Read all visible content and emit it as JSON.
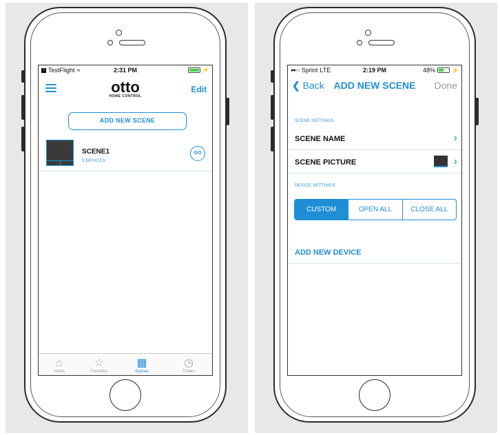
{
  "left": {
    "status": {
      "carrier": "TestFlight",
      "time": "2:31 PM"
    },
    "header": {
      "logo_word": "otto",
      "logo_sub": "HOME CONTROL",
      "edit_label": "Edit"
    },
    "add_scene_label": "ADD NEW SCENE",
    "scene": {
      "name": "SCENE1",
      "devices": "3 DEVICES",
      "go_label": "GO"
    },
    "tabs": [
      {
        "label": "Home",
        "icon": "home-icon"
      },
      {
        "label": "Favorites",
        "icon": "star-icon"
      },
      {
        "label": "Scenes",
        "icon": "scenes-icon"
      },
      {
        "label": "Timers",
        "icon": "clock-icon"
      }
    ],
    "active_tab": "Scenes"
  },
  "right": {
    "status": {
      "carrier": "Sprint",
      "network": "LTE",
      "time": "2:19 PM",
      "battery": "48%"
    },
    "nav": {
      "back_label": "Back",
      "title": "ADD NEW SCENE",
      "done_label": "Done"
    },
    "scene_settings_label": "SCENE SETTINGS",
    "scene_name_label": "SCENE NAME",
    "scene_picture_label": "SCENE PICTURE",
    "device_settings_label": "DEVICE SETTINGS",
    "segments": [
      "CUSTOM",
      "OPEN ALL",
      "CLOSE ALL"
    ],
    "add_device_label": "ADD NEW DEVICE"
  },
  "colors": {
    "accent": "#1f8ed4",
    "battery": "#3ecf4e"
  }
}
